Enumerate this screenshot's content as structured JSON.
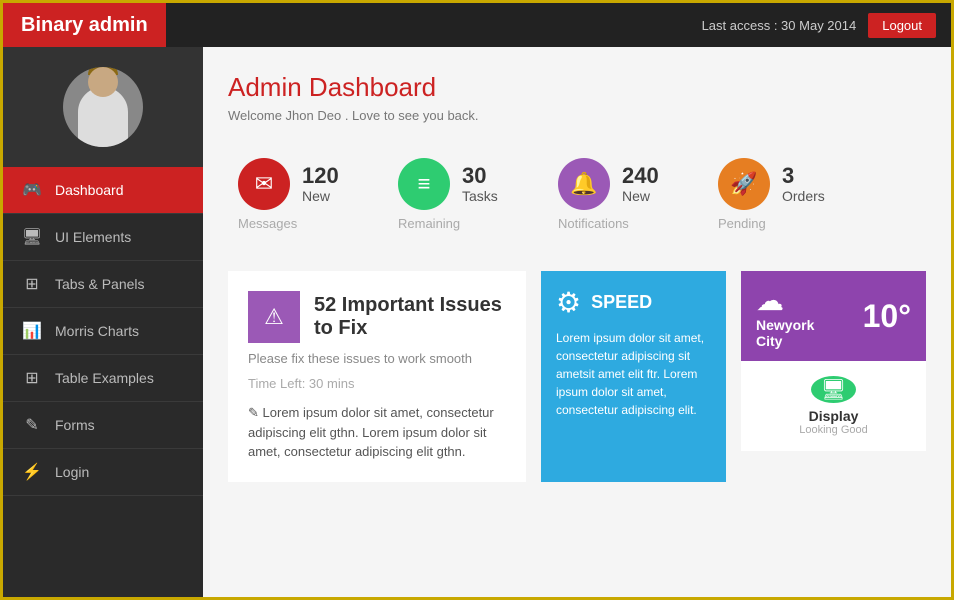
{
  "header": {
    "app_title": "Binary admin",
    "last_access": "Last access : 30 May 2014",
    "logout_label": "Logout"
  },
  "sidebar": {
    "nav_items": [
      {
        "id": "dashboard",
        "label": "Dashboard",
        "icon": "🎮",
        "active": true
      },
      {
        "id": "ui-elements",
        "label": "UI Elements",
        "icon": "🖥",
        "active": false
      },
      {
        "id": "tabs-panels",
        "label": "Tabs & Panels",
        "icon": "⊞",
        "active": false
      },
      {
        "id": "morris-charts",
        "label": "Morris Charts",
        "icon": "📊",
        "active": false
      },
      {
        "id": "table-examples",
        "label": "Table Examples",
        "icon": "⊞",
        "active": false
      },
      {
        "id": "forms",
        "label": "Forms",
        "icon": "✎",
        "active": false
      },
      {
        "id": "login",
        "label": "Login",
        "icon": "⚡",
        "active": false
      }
    ]
  },
  "main": {
    "title": "Admin Dashboard",
    "subtitle": "Welcome Jhon Deo . Love to see you back.",
    "stats": [
      {
        "id": "messages",
        "number": "120",
        "label_top": "New",
        "label": "Messages",
        "icon": "✉",
        "color": "red"
      },
      {
        "id": "tasks",
        "number": "30",
        "label_top": "Tasks",
        "label": "Remaining",
        "icon": "≡",
        "color": "green"
      },
      {
        "id": "notifications",
        "number": "240",
        "label_top": "New",
        "label": "Notifications",
        "icon": "🔔",
        "color": "purple"
      },
      {
        "id": "orders",
        "number": "3",
        "label_top": "Orders",
        "label": "Pending",
        "icon": "🚀",
        "color": "orange"
      }
    ],
    "alert": {
      "icon": "⚠",
      "title": "52 Important Issues to Fix",
      "subtitle": "Please fix these issues to work smooth",
      "time": "Time Left: 30 mins",
      "text": "Lorem ipsum dolor sit amet, consectetur adipiscing elit gthn. Lorem ipsum dolor sit amet, consectetur adipiscing elit gthn."
    },
    "speed_card": {
      "icon": "⚙",
      "title": "SPEED",
      "text": "Lorem ipsum dolor sit amet, consectetur adipiscing sit ametsit amet elit ftr. Lorem ipsum dolor sit amet, consectetur adipiscing elit."
    },
    "weather_card": {
      "temp": "10°",
      "city": "Newyork",
      "region": "City",
      "icon": "☁"
    },
    "display_card": {
      "label": "Display",
      "sub_label": "Looking Good",
      "icon": "🖥"
    }
  }
}
